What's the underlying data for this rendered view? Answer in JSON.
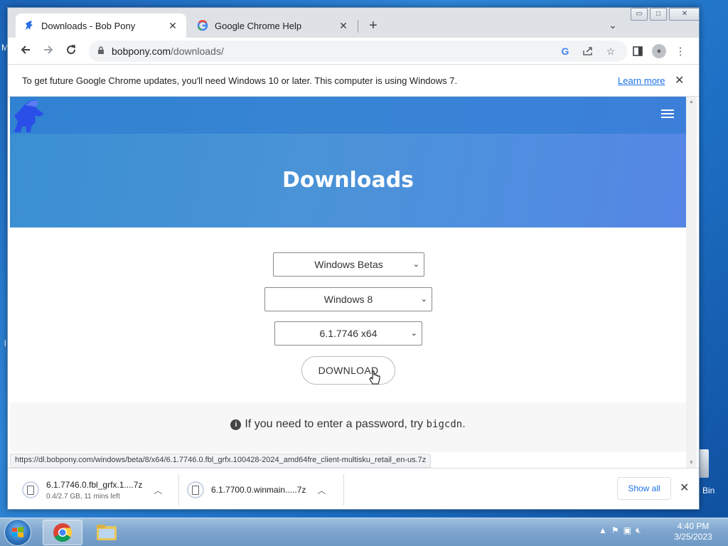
{
  "desktop": {
    "left_letter_1": "M",
    "left_letter_2": "l",
    "right_label": "Bin"
  },
  "window_controls": {
    "minimize": "▭",
    "maximize": "□",
    "close": "✕"
  },
  "tabs": [
    {
      "title": "Downloads - Bob Pony",
      "active": true
    },
    {
      "title": "Google Chrome Help",
      "active": false
    }
  ],
  "tab_close_glyph": "✕",
  "new_tab_glyph": "+",
  "tab_search_glyph": "⌄",
  "omnibox": {
    "domain": "bobpony.com",
    "path": "/downloads/"
  },
  "infobar": {
    "message": "To get future Google Chrome updates, you'll need Windows 10 or later. This computer is using Windows 7.",
    "link": "Learn more"
  },
  "page": {
    "heading": "Downloads",
    "select_channel": "Windows Betas",
    "select_os": "Windows 8",
    "select_build": "6.1.7746 x64",
    "download_button": "DOWNLOAD",
    "note_prefix": "If you need to enter a password, try ",
    "note_password": "bigcdn",
    "note_suffix": "."
  },
  "status_url": "https://dl.bobpony.com/windows/beta/8/x64/6.1.7746.0.fbl_grfx.100428-2024_amd64fre_client-multisku_retail_en-us.7z",
  "downloads_shelf": {
    "items": [
      {
        "name": "6.1.7746.0.fbl_grfx.1....7z",
        "status": "0.4/2.7 GB, 11 mins left"
      },
      {
        "name": "6.1.7700.0.winmain.....7z",
        "status": ""
      }
    ],
    "show_all": "Show all"
  },
  "taskbar": {
    "time": "4:40 PM",
    "date": "3/25/2023"
  },
  "colors": {
    "hero": "#4a93d6",
    "link": "#1a73e8",
    "desktop": "#1d6fc4"
  }
}
